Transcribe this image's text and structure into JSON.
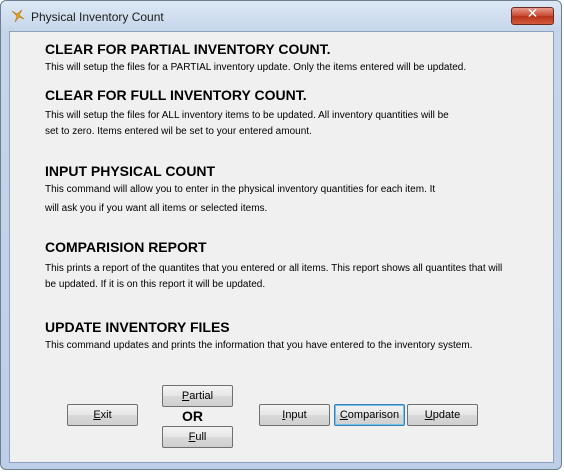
{
  "window": {
    "title": "Physical Inventory Count",
    "close_glyph": "✕"
  },
  "sections": [
    {
      "heading": "CLEAR FOR PARTIAL INVENTORY COUNT.",
      "lines": [
        "This will setup the files for a PARTIAL inventory update. Only the items entered will be updated."
      ]
    },
    {
      "heading": "CLEAR FOR FULL INVENTORY COUNT.",
      "lines": [
        "This will setup the files for ALL inventory items to be updated. All inventory quantities will be",
        " set to zero. Items entered wil be set to your entered amount."
      ]
    },
    {
      "heading": "INPUT PHYSICAL COUNT",
      "lines": [
        "This command will allow you to enter in the physical inventory quantities for each item. It",
        " will ask you if you want all items or selected items."
      ]
    },
    {
      "heading": "COMPARISION REPORT",
      "lines": [
        "This prints a report of the quantites that you entered or all items. This report shows all quantites that will",
        "be updated. If it is on this report it will be updated."
      ]
    },
    {
      "heading": "UPDATE INVENTORY FILES",
      "lines": [
        "This command updates and prints the information that you have entered to the inventory system."
      ]
    }
  ],
  "buttons": {
    "exit": {
      "mnemonic": "E",
      "rest": "xit"
    },
    "partial": {
      "mnemonic": "P",
      "rest": "artial"
    },
    "full": {
      "mnemonic": "F",
      "rest": "ull"
    },
    "input": {
      "mnemonic": "I",
      "rest": "nput"
    },
    "comparison": {
      "mnemonic": "C",
      "rest": "omparison"
    },
    "update": {
      "mnemonic": "U",
      "rest": "pdate"
    }
  },
  "or_label": "OR",
  "colors": {
    "title_bar": "#c6d6ea",
    "close": "#c7472f",
    "client_bg": "#f0f0f0",
    "focus": "#3c7fb1"
  }
}
